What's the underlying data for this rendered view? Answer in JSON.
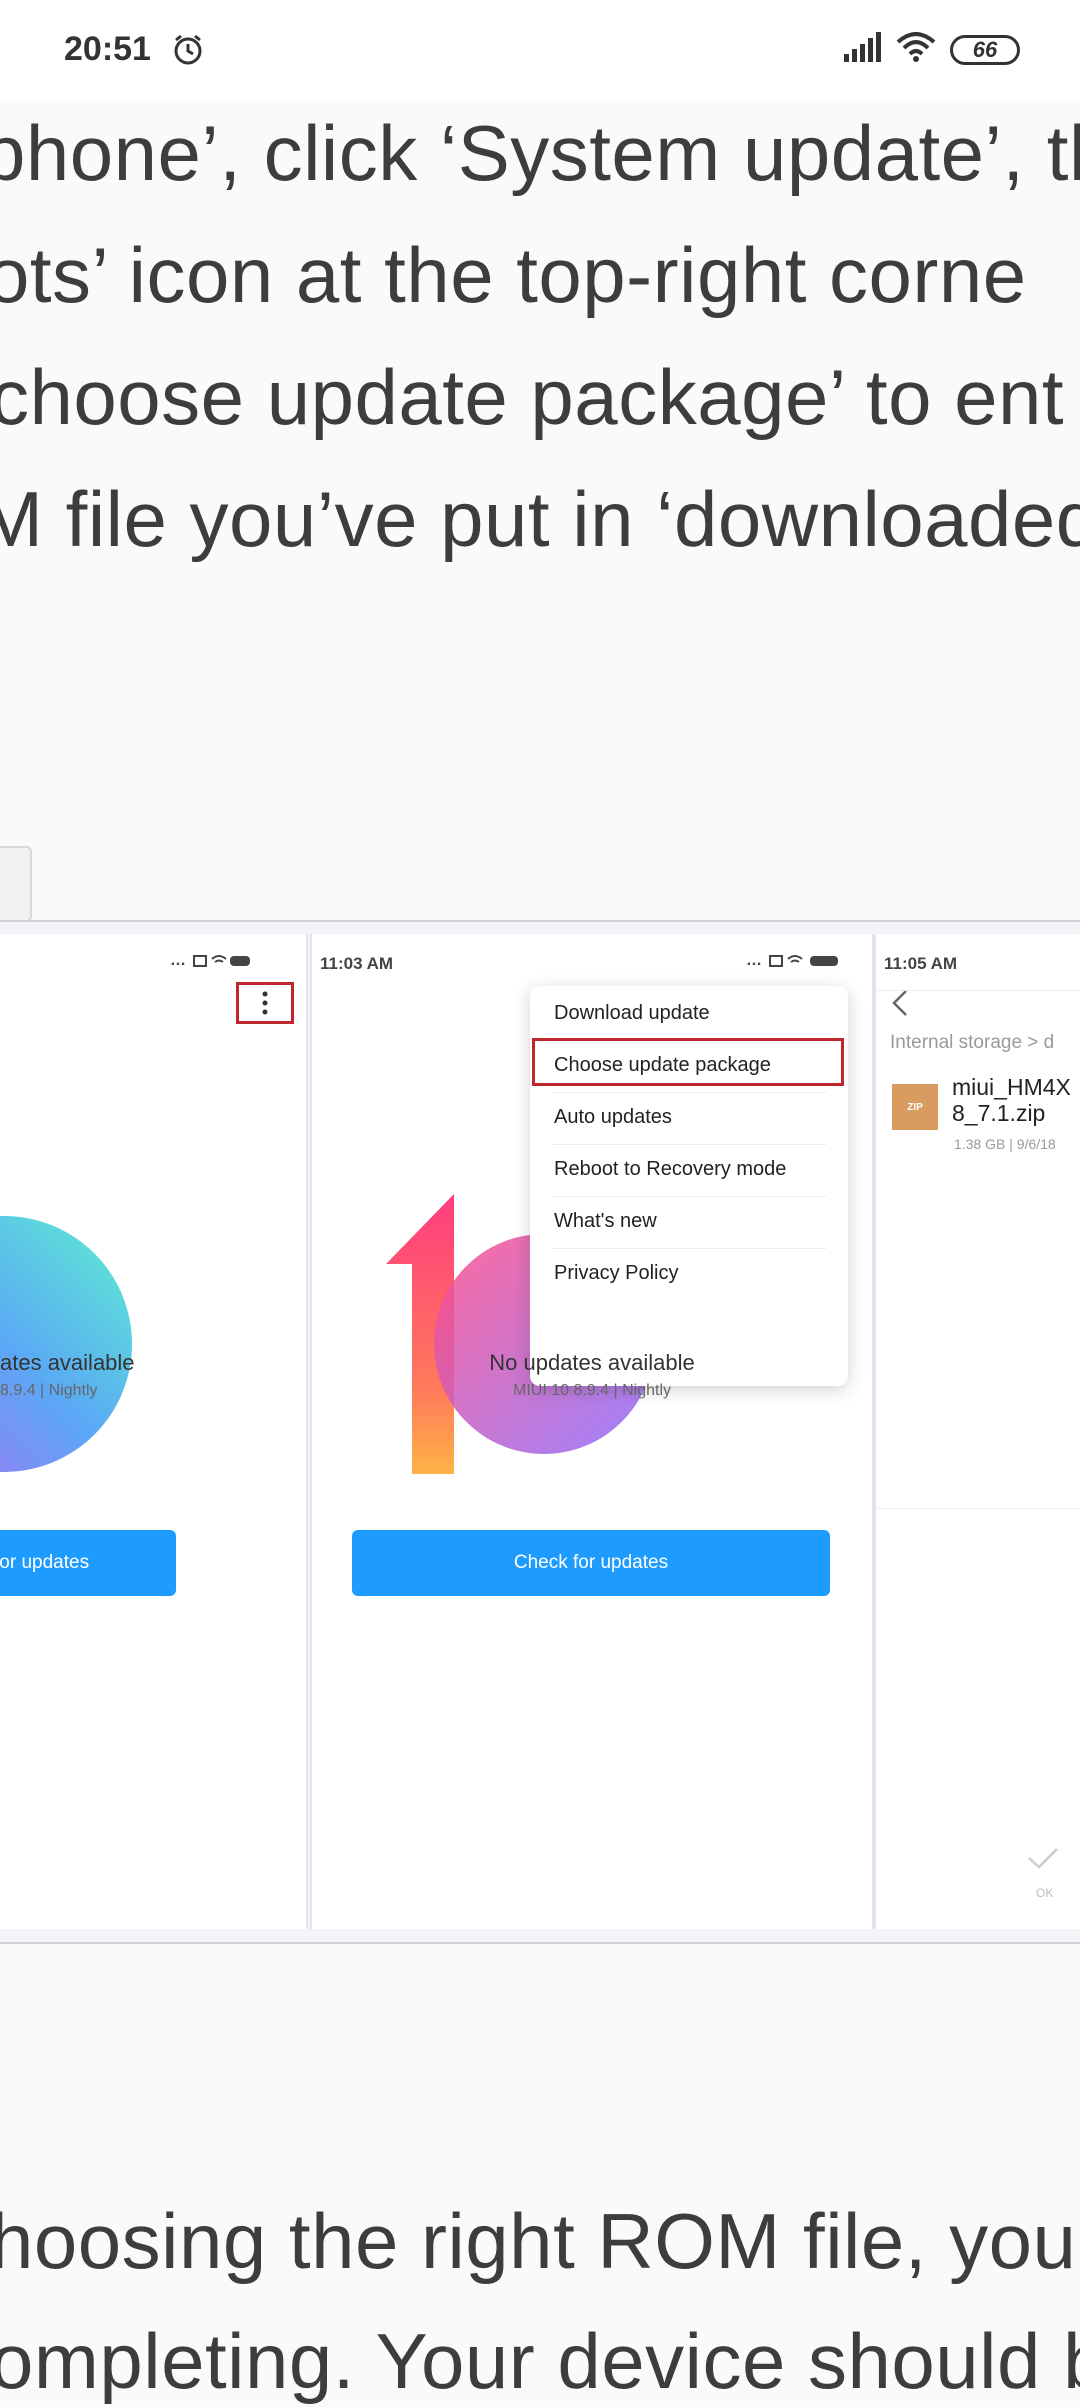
{
  "status_bar": {
    "time": "20:51",
    "battery": "66",
    "icons": [
      "alarm-icon",
      "signal-icon",
      "wifi-icon",
      "battery-icon"
    ]
  },
  "article": {
    "lines": [
      "phone’, click ‘System update’, th",
      "ots’ icon at the top-right corne",
      "choose update package’ to ent",
      "M file you’ve put in ‘downloaded",
      "hoosing the right ROM file, your",
      "ompleting. Your device should b"
    ]
  },
  "figure": {
    "panel1": {
      "status_icons": "…",
      "update_title": "ates available",
      "update_sub": "8.9.4 | Nightly",
      "button": "for updates"
    },
    "panel2": {
      "time": "11:03 AM",
      "status_icons": "…",
      "update_title": "No updates available",
      "update_sub": "MIUI 10 8.9.4 | Nightly",
      "button": "Check for updates",
      "menu": [
        "Download update",
        "Choose update package",
        "Auto updates",
        "Reboot to Recovery mode",
        "What's new",
        "Privacy Policy"
      ]
    },
    "panel3": {
      "time": "11:05 AM",
      "breadcrumb": "Internal storage > d",
      "zip_label": "ZIP",
      "file_name_1": "miui_HM4X",
      "file_name_2": "8_7.1.zip",
      "file_meta": "1.38 GB | 9/6/18",
      "ok": "OK"
    }
  },
  "colors": {
    "accent_blue": "#1e9bff",
    "highlight_red": "#c0262d"
  }
}
